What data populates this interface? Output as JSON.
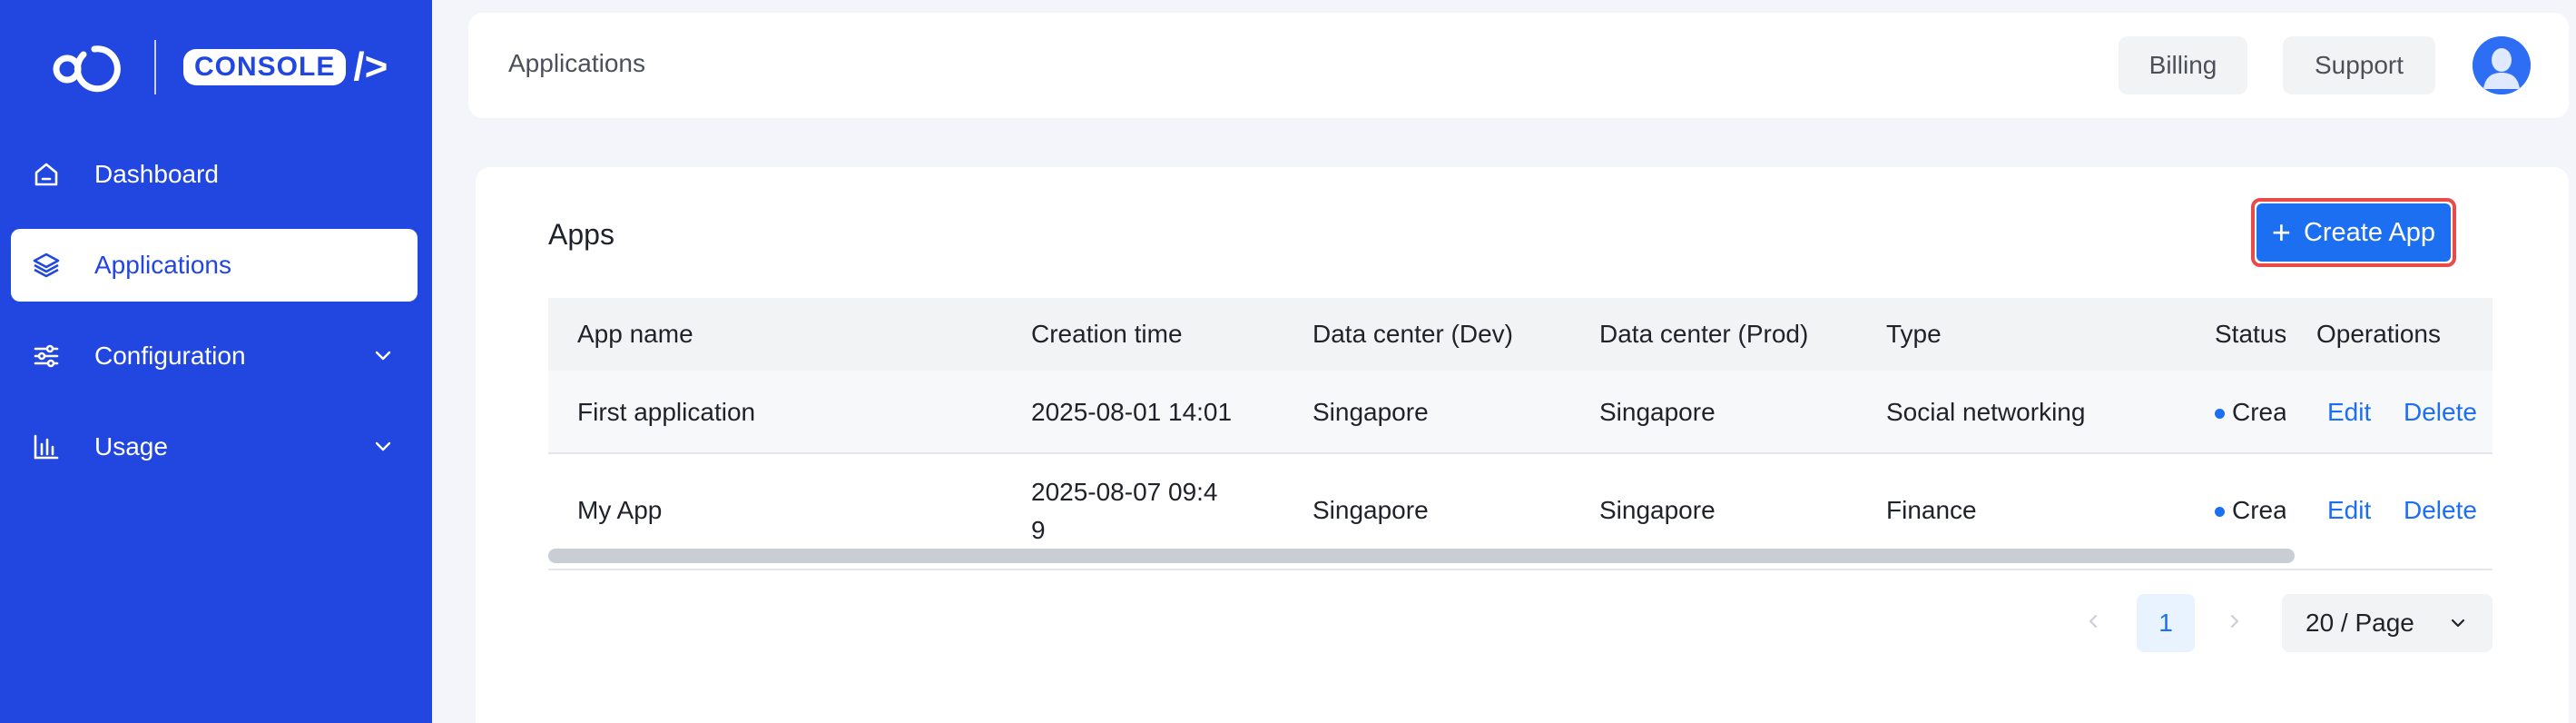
{
  "brand": {
    "logo_text": "CONSOLE",
    "logo_glyph": "/>"
  },
  "sidebar": {
    "items": [
      {
        "label": "Dashboard",
        "icon": "home-icon",
        "active": false,
        "expandable": false
      },
      {
        "label": "Applications",
        "icon": "layers-icon",
        "active": true,
        "expandable": false
      },
      {
        "label": "Configuration",
        "icon": "sliders-icon",
        "active": false,
        "expandable": true
      },
      {
        "label": "Usage",
        "icon": "bar-chart-icon",
        "active": false,
        "expandable": true
      }
    ]
  },
  "header": {
    "title": "Applications",
    "billing_label": "Billing",
    "support_label": "Support",
    "avatar_icon": "user-avatar-icon"
  },
  "main": {
    "title": "Apps",
    "create_button_label": "Create App",
    "columns": [
      "App name",
      "Creation time",
      "Data center (Dev)",
      "Data center (Prod)",
      "Type",
      "Status",
      "Operations"
    ],
    "rows": [
      {
        "app_name": "First application",
        "creation_time": "2025-08-01 14:01",
        "dc_dev": "Singapore",
        "dc_prod": "Singapore",
        "type": "Social networking",
        "status": "Crea",
        "edit_label": "Edit",
        "delete_label": "Delete"
      },
      {
        "app_name": "My App",
        "creation_time_line1": "2025-08-07 09:4",
        "creation_time_line2": "9",
        "dc_dev": "Singapore",
        "dc_prod": "Singapore",
        "type": "Finance",
        "status": "Crea",
        "edit_label": "Edit",
        "delete_label": "Delete"
      }
    ],
    "pagination": {
      "current_page": "1",
      "page_size": "20 / Page"
    }
  },
  "colors": {
    "sidebar_bg": "#2246e0",
    "primary": "#1d6ff2",
    "highlight_outline": "#e94a4a"
  }
}
